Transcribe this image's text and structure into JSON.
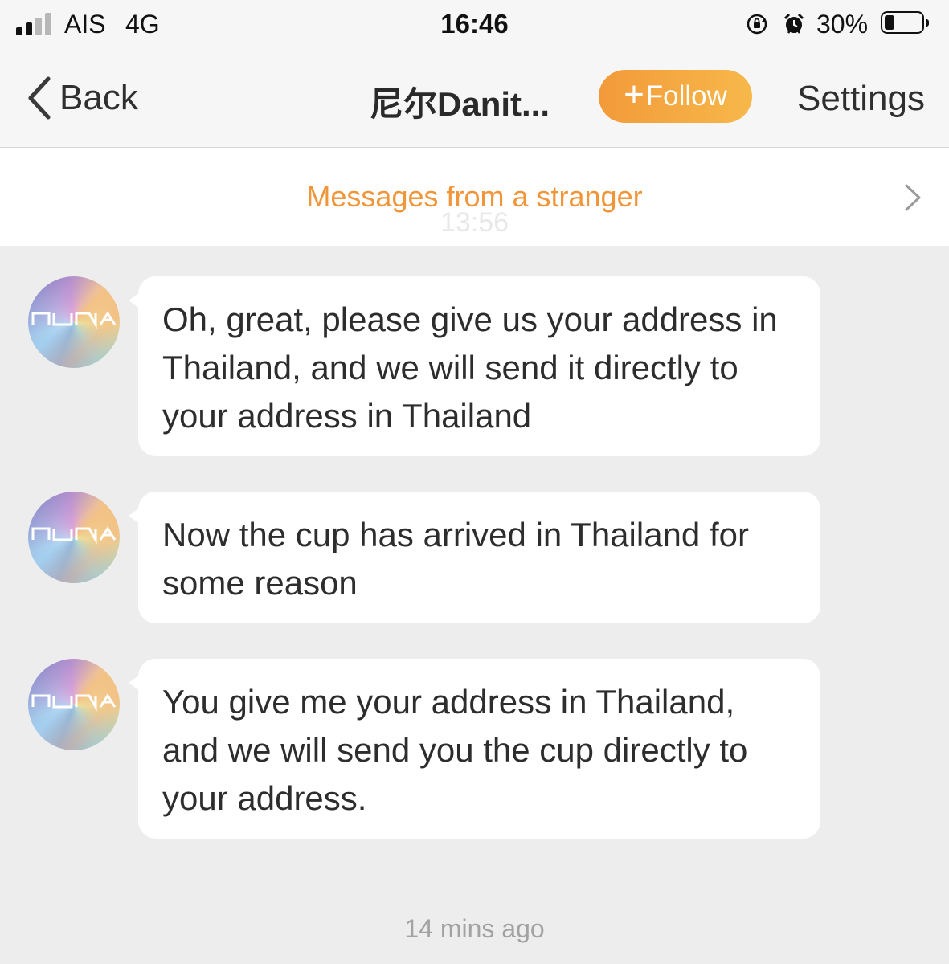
{
  "status_bar": {
    "carrier": "AIS",
    "network": "4G",
    "time": "16:46",
    "battery_percent": "30%",
    "battery_level": 0.3,
    "icons": [
      "signal-icon",
      "rotation-lock-icon",
      "alarm-icon",
      "battery-icon"
    ]
  },
  "nav": {
    "back_label": "Back",
    "title": "尼尔Danit...",
    "follow_plus": "+",
    "follow_label": "Follow",
    "settings_label": "Settings"
  },
  "banner": {
    "label": "Messages from a stranger",
    "ghost_time": "13:56"
  },
  "messages": [
    {
      "text": "Oh, great, please give us your address in Thailand, and we will send it directly to your address in Thailand"
    },
    {
      "text": "Now the cup has arrived in Thailand for some reason"
    },
    {
      "text": "You give me your address in Thailand, and we will send you the cup directly to your address."
    }
  ],
  "footer": {
    "time": "14 mins ago"
  },
  "colors": {
    "accent_orange": "#f0963a",
    "follow_gradient_start": "#f29a3a",
    "follow_gradient_end": "#f7b84a",
    "chat_background": "#ededed",
    "bubble": "#ffffff"
  }
}
